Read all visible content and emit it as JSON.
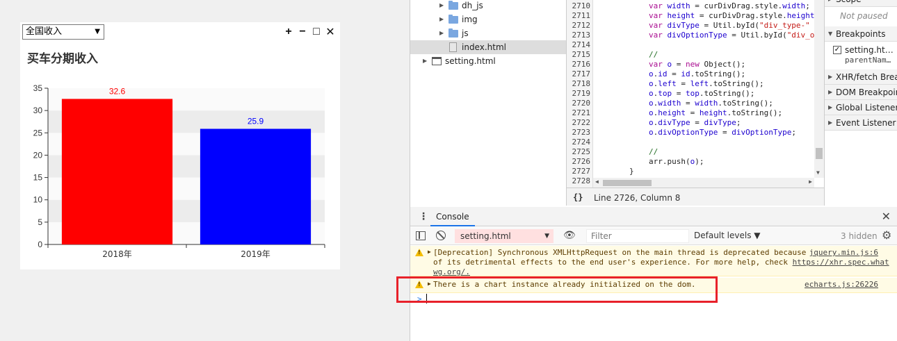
{
  "widget": {
    "select_value": "全国收入",
    "title": "买车分期收入",
    "controls": [
      "+",
      "−",
      "□",
      "✕"
    ]
  },
  "chart_data": {
    "type": "bar",
    "categories": [
      "2018年",
      "2019年"
    ],
    "values": [
      32.6,
      25.9
    ],
    "labels": [
      "32.6",
      "25.9"
    ],
    "colors": [
      "#ff0000",
      "#0000ff"
    ],
    "title": "买车分期收入",
    "ylim": [
      0,
      35
    ],
    "yticks": [
      0,
      5,
      10,
      15,
      20,
      25,
      30,
      35
    ],
    "grid": "alternating bands"
  },
  "file_tree": [
    {
      "label": "dh_js",
      "type": "folder"
    },
    {
      "label": "img",
      "type": "folder"
    },
    {
      "label": "js",
      "type": "folder"
    },
    {
      "label": "index.html",
      "type": "file",
      "selected": true
    },
    {
      "label": "setting.html",
      "type": "window"
    }
  ],
  "code": {
    "line_numbers": [
      "2710",
      "2711",
      "2712",
      "2713",
      "2714",
      "2715",
      "2716",
      "2717",
      "2718",
      "2719",
      "2720",
      "2721",
      "2722",
      "2723",
      "2724",
      "2725",
      "2726",
      "2727",
      "2728"
    ],
    "lines": [
      "var width = curDivDrag.style.width;",
      "var height = curDivDrag.style.height",
      "var divType = Util.byId(\"div_type-\"",
      "var divOptionType = Util.byId(\"div_o",
      "",
      "//",
      "var o = new Object();",
      "o.id = id.toString();",
      "o.left = left.toString();",
      "o.top = top.toString();",
      "o.width = width.toString();",
      "o.height = height.toString();",
      "o.divType = divType;",
      "o.divOptionType = divOptionType;",
      "",
      "//",
      "arr.push(o);",
      "}",
      ""
    ]
  },
  "status": {
    "braces": "{}",
    "position": "Line 2726, Column 8"
  },
  "right_panel": {
    "scope": "Scope",
    "not_paused": "Not paused",
    "breakpoints": "Breakpoints",
    "bp_file": "setting.ht…",
    "bp_code": "parentNam…",
    "xhr": "XHR/fetch Breakpoints",
    "dom": "DOM Breakpoints",
    "global": "Global Listeners",
    "event": "Event Listener Breakpoints"
  },
  "console": {
    "tab": "Console",
    "context": "setting.html",
    "filter_placeholder": "Filter",
    "levels": "Default levels ▼",
    "hidden": "3 hidden",
    "msg1_text": "[Deprecation] Synchronous XMLHttpRequest on the main thread is deprecated because",
    "msg1_src": "jquery.min.js:6",
    "msg1_text2": "of its detrimental effects to the end user's experience. For more help, check",
    "msg1_link": "https://xhr.spec.what",
    "msg1_text3": "wg.org/.",
    "msg2_text": "There is a chart instance already initialized on the dom.",
    "msg2_src": "echarts.js:26226",
    "prompt": ">"
  }
}
